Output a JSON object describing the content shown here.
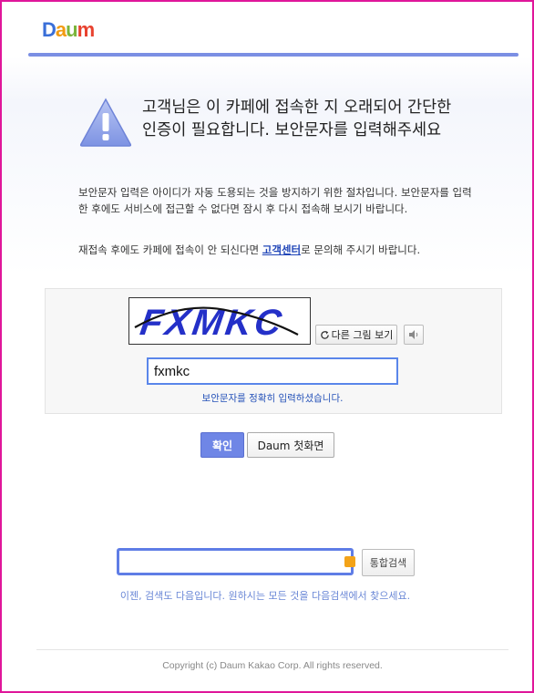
{
  "logo": {
    "text": "Daum"
  },
  "headline": "고객님은 이 카페에 접속한 지 오래되어 간단한 인증이 필요합니다. 보안문자를 입력해주세요",
  "description": "보안문자 입력은 아이디가 자동 도용되는 것을 방지하기 위한 절차입니다. 보안문자를 입력한 후에도 서비스에 접근할 수 없다면 잠시 후 다시 접속해 보시기 바랍니다.",
  "reconnect": {
    "before": "재접속 후에도 카페에 접속이 안 되신다면 ",
    "link": "고객센터",
    "after": "로 문의해 주시기 바랍니다."
  },
  "captcha": {
    "image_text": "FXMKC",
    "refresh_label": "다른 그림 보기",
    "input_value": "fxmkc",
    "message": "보안문자를 정확히 입력하셨습니다."
  },
  "buttons": {
    "confirm": "확인",
    "home": "Daum 첫화면"
  },
  "search": {
    "value": "",
    "button": "통합검색",
    "hint": "이젠, 검색도 다음입니다. 원하시는 모든 것을 다음검색에서 찾으세요."
  },
  "footer": {
    "copyright": "Copyright (c) Daum Kakao Corp. All rights reserved."
  },
  "colors": {
    "accent": "#6f86e6",
    "frame": "#e0169a",
    "link": "#2146b8",
    "search_handle": "#f3a319"
  },
  "icons": [
    "warning-icon",
    "refresh-icon",
    "speaker-icon"
  ]
}
